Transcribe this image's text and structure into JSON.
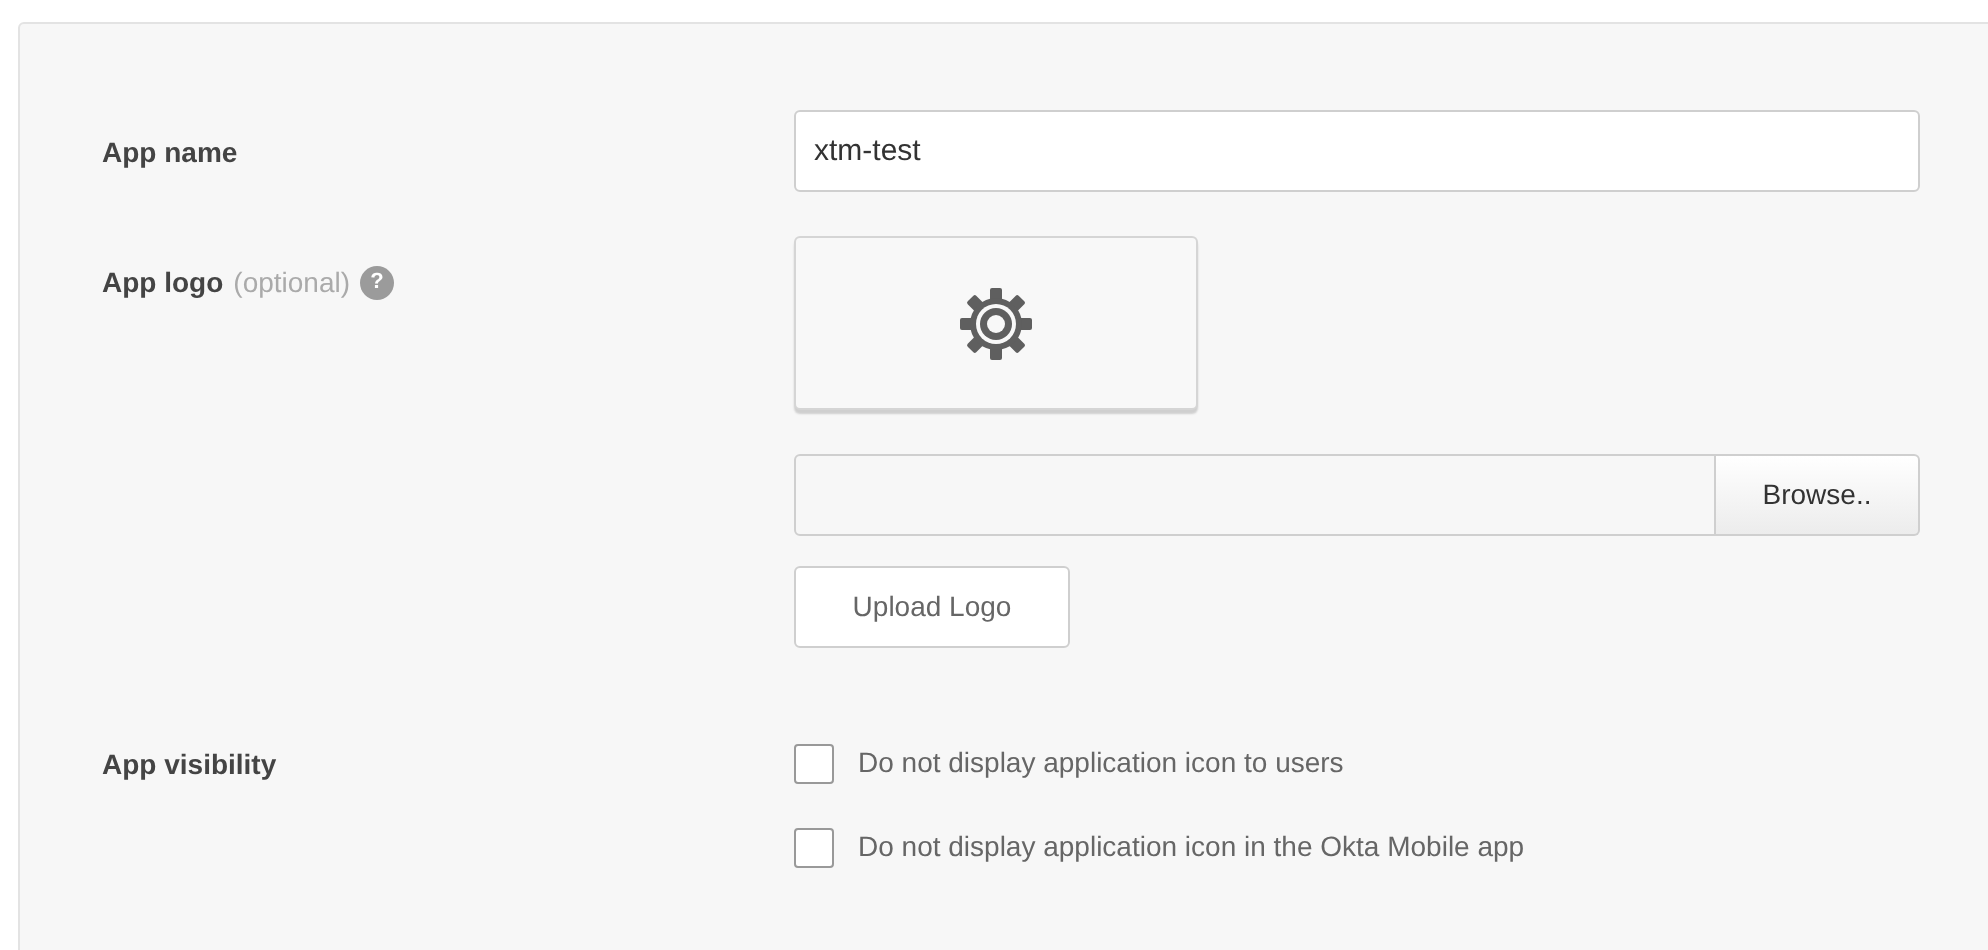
{
  "app_name": {
    "label": "App name",
    "value": "xtm-test"
  },
  "app_logo": {
    "label": "App logo",
    "hint": "(optional)",
    "help": "?",
    "browse_button": "Browse..",
    "upload_button": "Upload Logo"
  },
  "app_visibility": {
    "label": "App visibility",
    "options": [
      {
        "label": "Do not display application icon to users",
        "checked": false
      },
      {
        "label": "Do not display application icon in the Okta Mobile app",
        "checked": false
      }
    ]
  }
}
